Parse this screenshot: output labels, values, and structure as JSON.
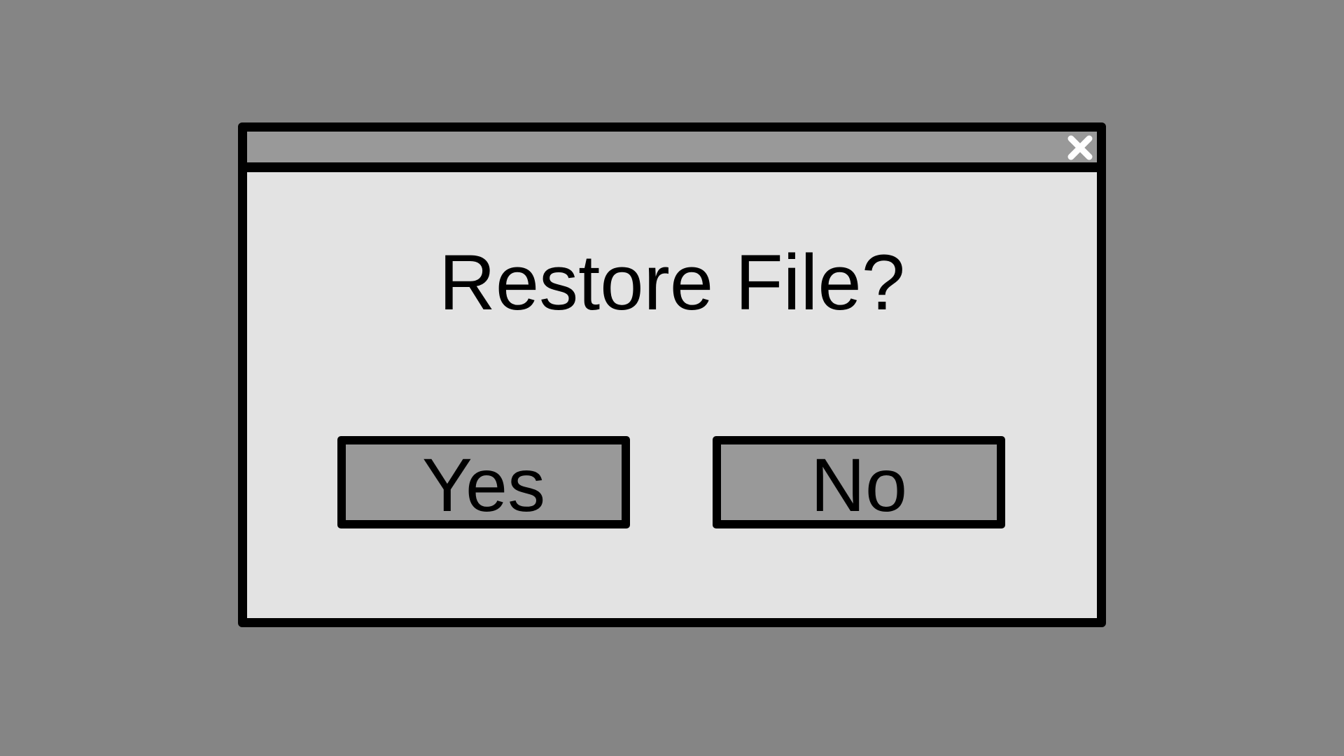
{
  "dialog": {
    "message": "Restore File?",
    "yes_label": "Yes",
    "no_label": "No",
    "close_icon": "close-icon"
  },
  "colors": {
    "background": "#858585",
    "dialog_body": "#e3e3e3",
    "titlebar": "#999999",
    "button_fill": "#999999",
    "border": "#000000",
    "close_glyph": "#ffffff"
  }
}
